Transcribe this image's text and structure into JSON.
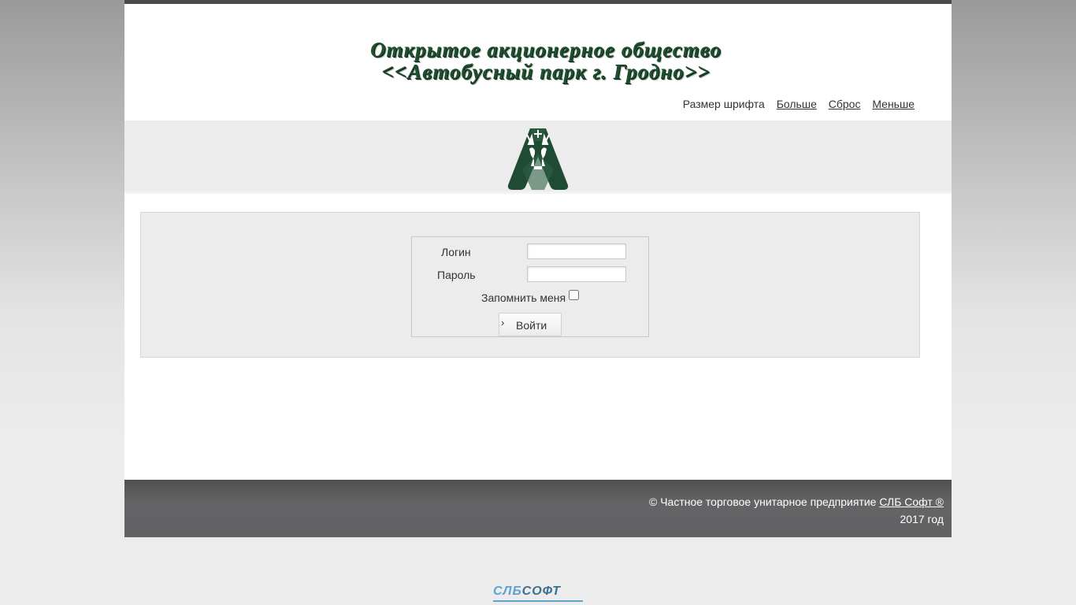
{
  "header": {
    "title_line1": "Открытое акционерное общество",
    "title_line2": "<<Автобусный парк г. Гродно>>",
    "font_size_label": "Размер шрифта",
    "font_more": "Больше",
    "font_reset": "Сброс",
    "font_less": "Меньше"
  },
  "logo": {
    "icon": "deer-letter-a-logo",
    "color": "#1f4a34"
  },
  "login": {
    "login_label": "Логин",
    "login_value": "",
    "password_label": "Пароль",
    "password_value": "",
    "remember_label": "Запомнить меня",
    "remember_checked": false,
    "submit_label": "Войти",
    "submit_icon": "›"
  },
  "footer": {
    "copyright_prefix": "© Частное торговое унитарное предприятие",
    "company_link": "СЛБ Софт ®",
    "year": "2017 год"
  },
  "vendor_logo": {
    "part1": "СЛБ",
    "part2": "СОФТ"
  }
}
